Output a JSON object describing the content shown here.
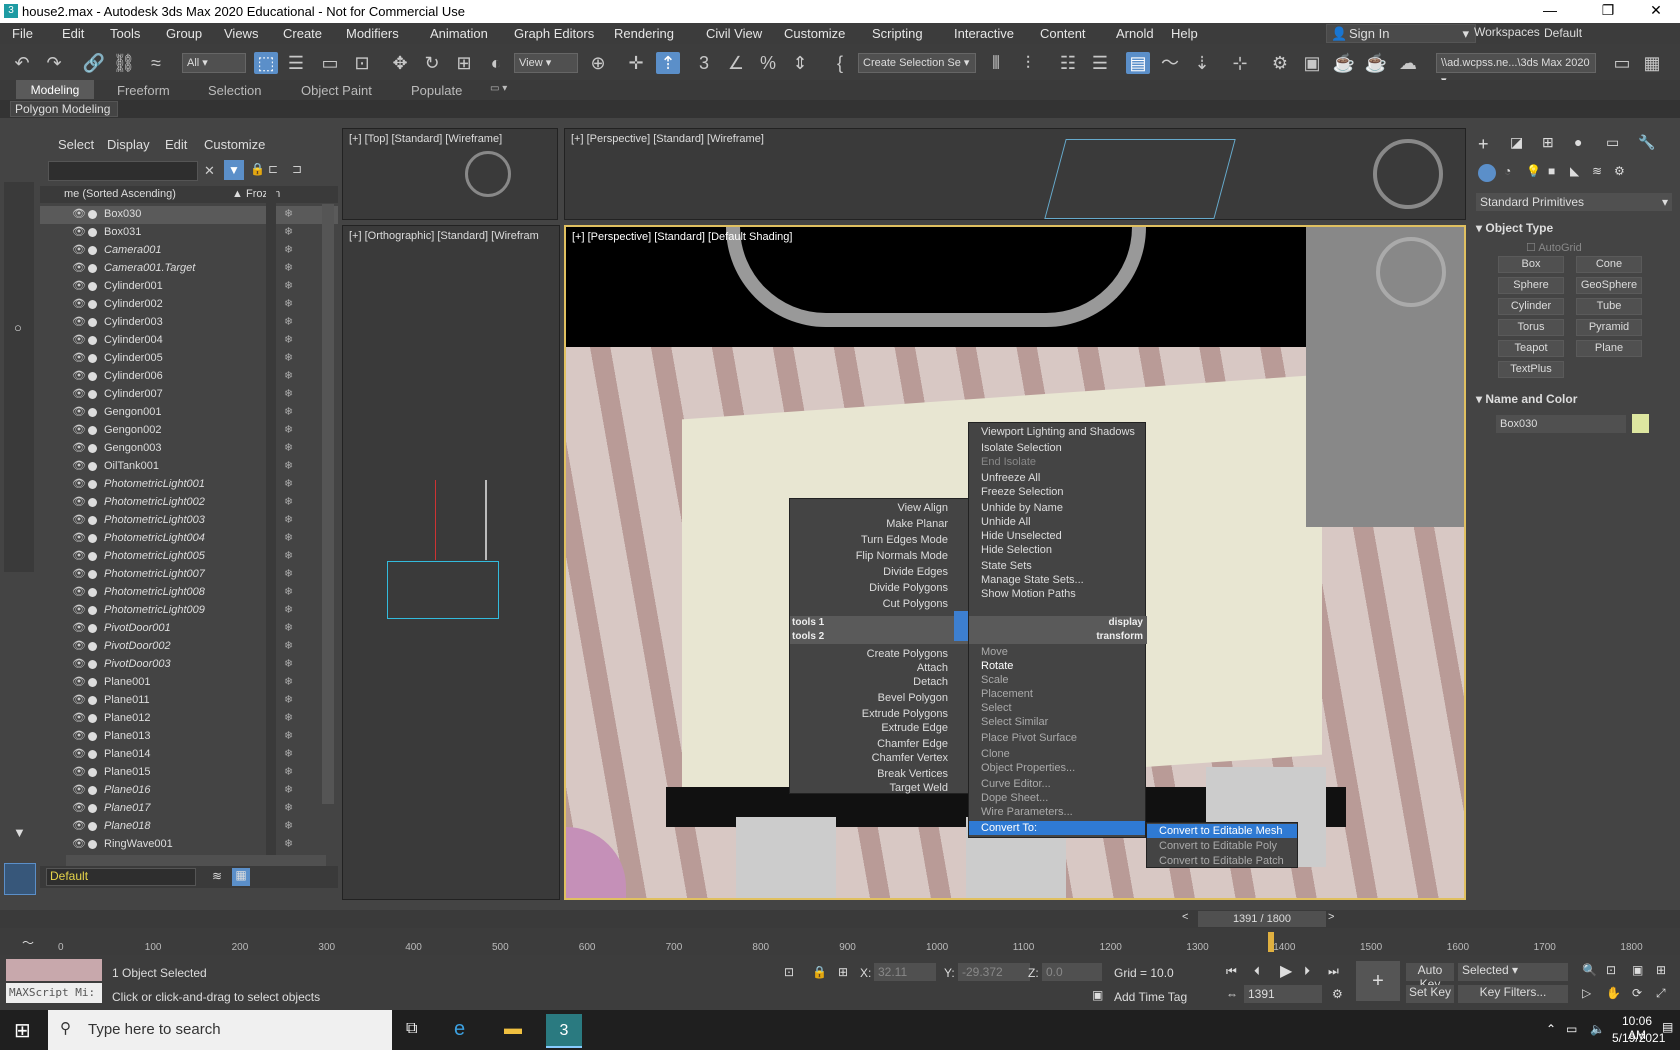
{
  "window": {
    "title": "house2.max - Autodesk 3ds Max 2020 Educational - Not for Commercial Use"
  },
  "menubar": {
    "items": [
      "File",
      "Edit",
      "Tools",
      "Group",
      "Views",
      "Create",
      "Modifiers",
      "Animation",
      "Graph Editors",
      "Rendering",
      "Civil View",
      "Customize",
      "Scripting",
      "Interactive",
      "Content",
      "Arnold",
      "Help"
    ],
    "sign_in": "Sign In",
    "workspaces_label": "Workspaces:",
    "workspace": "Default"
  },
  "toolbar": {
    "filter": "All",
    "view": "View",
    "selection_set": "Create Selection Se",
    "path": "\\\\ad.wcpss.ne...\\3ds Max 2020"
  },
  "ribbon": {
    "tabs": [
      "Modeling",
      "Freeform",
      "Selection",
      "Object Paint",
      "Populate"
    ],
    "sub": "Polygon Modeling"
  },
  "scene_explorer": {
    "tabs": [
      "Select",
      "Display",
      "Edit",
      "Customize"
    ],
    "col_name": "me (Sorted Ascending)",
    "col_frozen": "Frozen",
    "layer": "Default",
    "rows": [
      {
        "n": "Box030",
        "i": false
      },
      {
        "n": "Box031",
        "i": false
      },
      {
        "n": "Camera001",
        "i": true
      },
      {
        "n": "Camera001.Target",
        "i": true
      },
      {
        "n": "Cylinder001",
        "i": false
      },
      {
        "n": "Cylinder002",
        "i": false
      },
      {
        "n": "Cylinder003",
        "i": false
      },
      {
        "n": "Cylinder004",
        "i": false
      },
      {
        "n": "Cylinder005",
        "i": false
      },
      {
        "n": "Cylinder006",
        "i": false
      },
      {
        "n": "Cylinder007",
        "i": false
      },
      {
        "n": "Gengon001",
        "i": false
      },
      {
        "n": "Gengon002",
        "i": false
      },
      {
        "n": "Gengon003",
        "i": false
      },
      {
        "n": "OilTank001",
        "i": false
      },
      {
        "n": "PhotometricLight001",
        "i": true
      },
      {
        "n": "PhotometricLight002",
        "i": true
      },
      {
        "n": "PhotometricLight003",
        "i": true
      },
      {
        "n": "PhotometricLight004",
        "i": true
      },
      {
        "n": "PhotometricLight005",
        "i": true
      },
      {
        "n": "PhotometricLight007",
        "i": true
      },
      {
        "n": "PhotometricLight008",
        "i": true
      },
      {
        "n": "PhotometricLight009",
        "i": true
      },
      {
        "n": "PivotDoor001",
        "i": true
      },
      {
        "n": "PivotDoor002",
        "i": true
      },
      {
        "n": "PivotDoor003",
        "i": true
      },
      {
        "n": "Plane001",
        "i": false
      },
      {
        "n": "Plane011",
        "i": false
      },
      {
        "n": "Plane012",
        "i": false
      },
      {
        "n": "Plane013",
        "i": false
      },
      {
        "n": "Plane014",
        "i": false
      },
      {
        "n": "Plane015",
        "i": false
      },
      {
        "n": "Plane016",
        "i": true
      },
      {
        "n": "Plane017",
        "i": true
      },
      {
        "n": "Plane018",
        "i": true
      },
      {
        "n": "RingWave001",
        "i": false
      }
    ]
  },
  "viewports": {
    "top": "[+] [Top] [Standard] [Wireframe]",
    "persp_small": "[+] [Perspective] [Standard] [Wireframe]",
    "ortho": "[+] [Orthographic] [Standard] [Wirefram",
    "main": "[+] [Perspective] [Standard] [Default Shading]"
  },
  "quad_left": {
    "items": [
      "View Align",
      "Make Planar",
      "Turn Edges Mode",
      "Flip Normals Mode",
      "Divide Edges",
      "Divide Polygons",
      "Cut Polygons"
    ],
    "h1": "tools 1",
    "h2": "tools 2",
    "items2": [
      "Create Polygons",
      "Attach",
      "Detach",
      "Bevel Polygon",
      "Extrude Polygons",
      "Extrude Edge",
      "Chamfer Edge",
      "Chamfer Vertex",
      "Break Vertices",
      "Target Weld"
    ]
  },
  "quad_right": {
    "items": [
      "Viewport Lighting and Shadows",
      "Isolate Selection",
      "End Isolate",
      "Unfreeze All",
      "Freeze Selection",
      "Unhide by Name",
      "Unhide All",
      "Hide Unselected",
      "Hide Selection",
      "State Sets",
      "Manage State Sets...",
      "Show Motion Paths"
    ],
    "h1": "display",
    "h2": "transform",
    "items2": [
      "Move",
      "Rotate",
      "Scale",
      "Placement",
      "Select",
      "Select Similar",
      "Place Pivot Surface",
      "Clone",
      "Object Properties...",
      "Curve Editor...",
      "Dope Sheet...",
      "Wire Parameters...",
      "Convert To:"
    ]
  },
  "submenu": {
    "items": [
      "Convert to Editable Mesh",
      "Convert to Editable Poly",
      "Convert to Editable Patch"
    ]
  },
  "command_panel": {
    "category": "Standard Primitives",
    "object_type": "Object Type",
    "autogrid": "AutoGrid",
    "buttons": [
      "Box",
      "Cone",
      "Sphere",
      "GeoSphere",
      "Cylinder",
      "Tube",
      "Torus",
      "Pyramid",
      "Teapot",
      "Plane",
      "TextPlus"
    ],
    "name_color": "Name and Color",
    "name": "Box030",
    "color": "#dde6a0"
  },
  "timeline": {
    "frame": "1391 / 1800",
    "ticks": [
      "0",
      "100",
      "200",
      "300",
      "400",
      "500",
      "600",
      "700",
      "800",
      "900",
      "1000",
      "1100",
      "1200",
      "1300",
      "1400",
      "1500",
      "1600",
      "1700",
      "1800"
    ]
  },
  "status": {
    "maxscript": "MAXScript Mi:",
    "selected": "1 Object Selected",
    "prompt": "Click or click-and-drag to select objects",
    "x": "32.11",
    "y": "-29.372",
    "z": "0.0",
    "x_label": "X:",
    "y_label": "Y:",
    "z_label": "Z:",
    "grid": "Grid = 10.0",
    "add_time_tag": "Add Time Tag",
    "auto_key": "Auto Key",
    "set_key": "Set Key",
    "key_mode": "Selected",
    "key_filters": "Key Filters...",
    "frame_field": "1391"
  },
  "taskbar": {
    "search": "Type here to search",
    "time": "10:06 AM",
    "date": "5/19/2021"
  }
}
